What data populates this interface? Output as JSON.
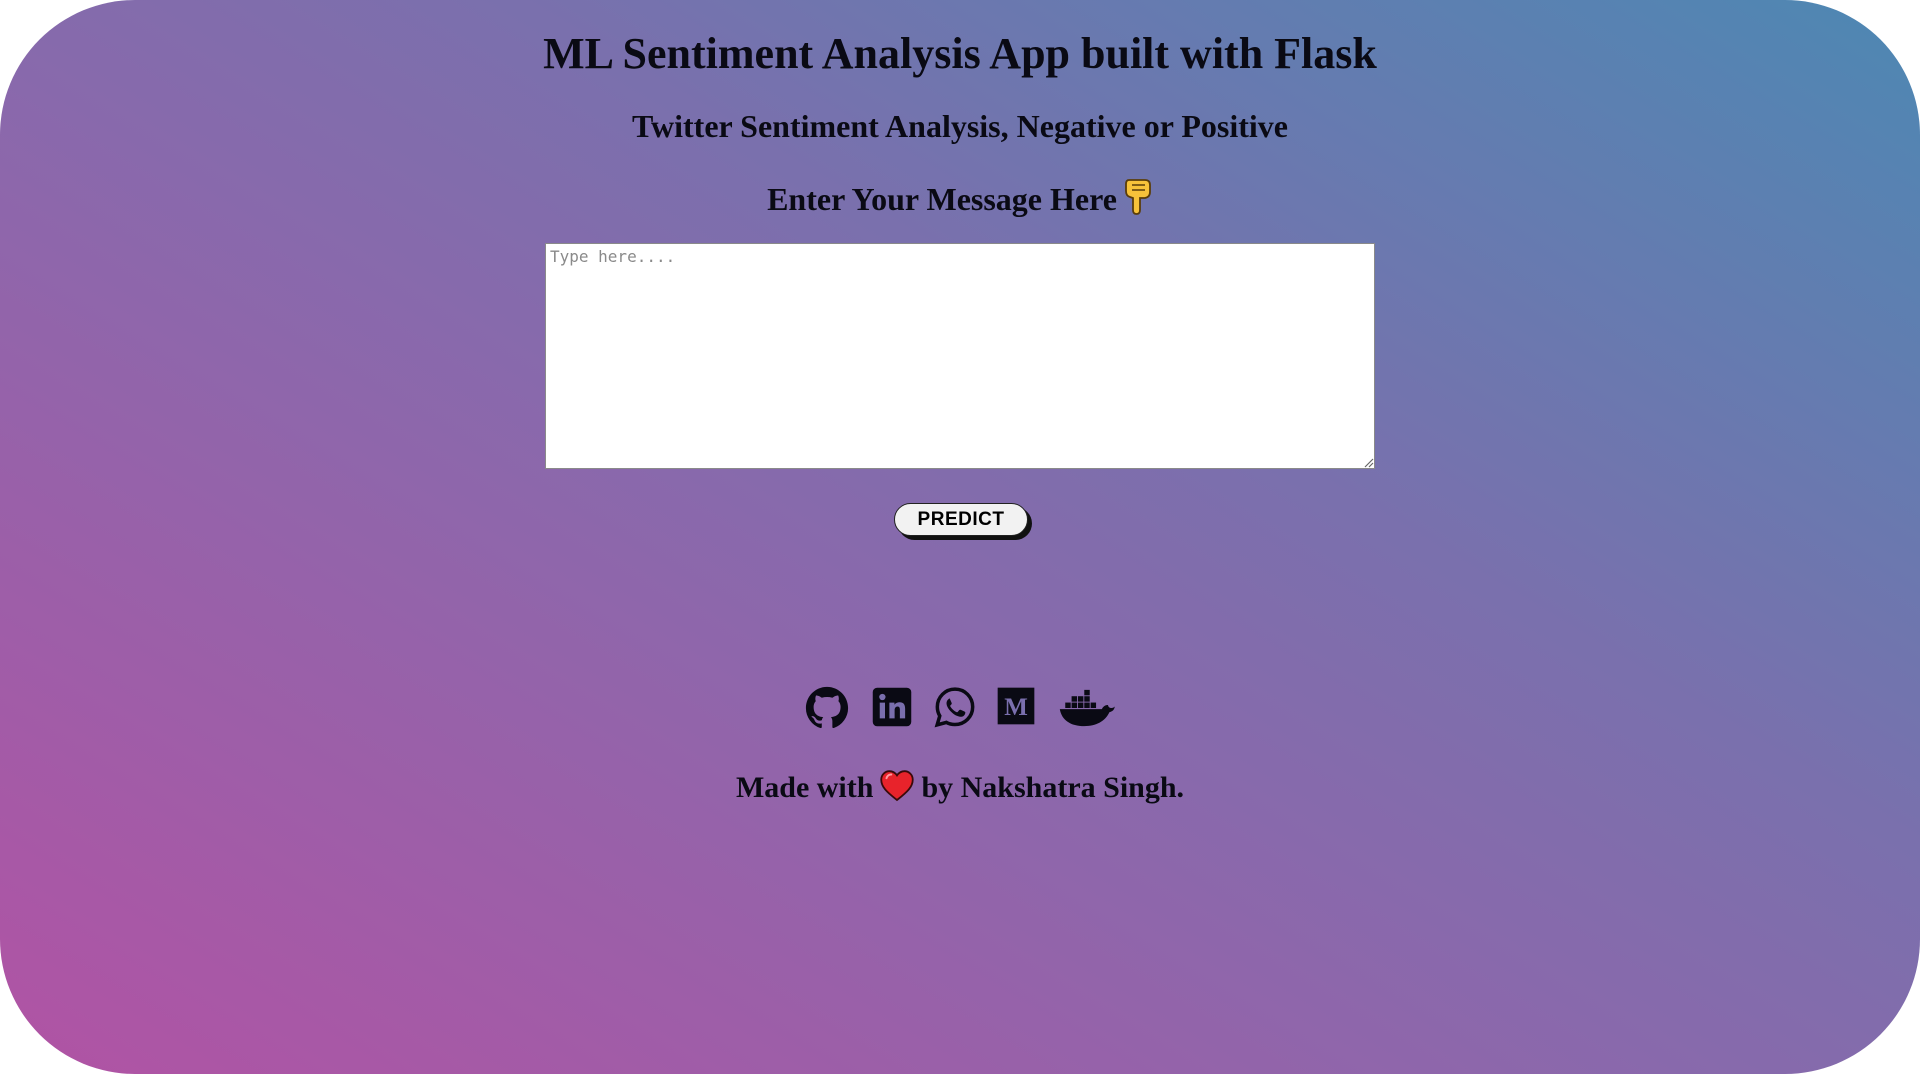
{
  "header": {
    "title": "ML Sentiment Analysis App built with Flask",
    "subtitle": "Twitter Sentiment Analysis, Negative or Positive",
    "prompt": "Enter Your Message Here"
  },
  "form": {
    "message_placeholder": "Type here....",
    "message_value": "",
    "predict_label": "PREDICT"
  },
  "social_links": [
    {
      "name": "github",
      "icon": "github-icon"
    },
    {
      "name": "linkedin",
      "icon": "linkedin-icon"
    },
    {
      "name": "whatsapp",
      "icon": "whatsapp-icon"
    },
    {
      "name": "medium",
      "icon": "medium-icon"
    },
    {
      "name": "docker",
      "icon": "docker-icon"
    }
  ],
  "footer": {
    "made_with": "Made with",
    "by_text": "by Nakshatra Singh."
  },
  "colors": {
    "gradient_start": "#b153a4",
    "gradient_mid": "#8f66ab",
    "gradient_end": "#4d88b3",
    "text": "#0a0a14",
    "heart": "#e8232b",
    "pointing_hand": "#f7c23a"
  }
}
